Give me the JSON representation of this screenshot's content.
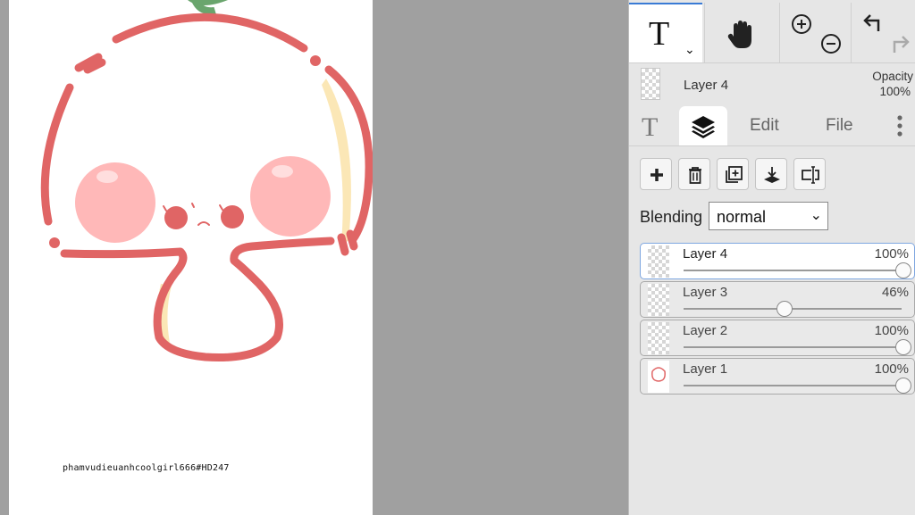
{
  "canvas": {
    "credit_text": "phamvudieuanhcoolgirl666#HD247"
  },
  "toolbar": {
    "text_tool_glyph": "T",
    "text_tool_caret": "⌄"
  },
  "current_layer": {
    "name": "Layer 4",
    "opacity_label": "Opacity",
    "opacity_value": "100%"
  },
  "tabs": {
    "text_glyph": "T",
    "edit_label": "Edit",
    "file_label": "File"
  },
  "blending": {
    "label": "Blending",
    "value": "normal"
  },
  "layers": [
    {
      "name": "Layer 4",
      "opacity_text": "100%",
      "opacity": 1.0,
      "selected": true
    },
    {
      "name": "Layer 3",
      "opacity_text": "46%",
      "opacity": 0.46,
      "selected": false
    },
    {
      "name": "Layer 2",
      "opacity_text": "100%",
      "opacity": 1.0,
      "selected": false
    },
    {
      "name": "Layer 1",
      "opacity_text": "100%",
      "opacity": 1.0,
      "selected": false
    }
  ],
  "colors": {
    "outline": "#e06565",
    "blush": "#ffb8b8",
    "stem": "#6aa56d",
    "cream": "#fbe7b6",
    "active_tab_accent": "#3a7bd5"
  }
}
